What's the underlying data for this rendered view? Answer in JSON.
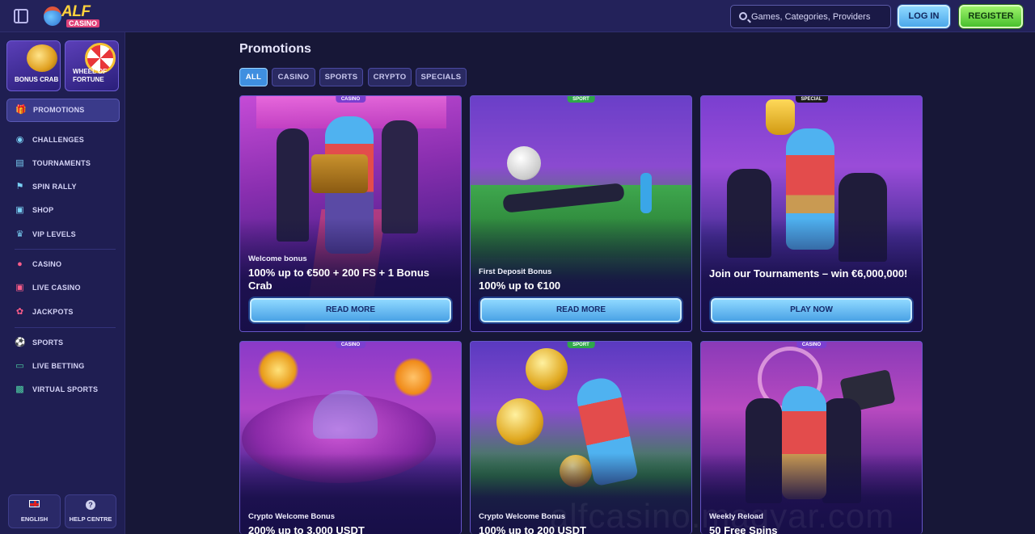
{
  "header": {
    "logo_text": "ALF",
    "logo_sub": "CASINO",
    "search_placeholder": "Games, Categories, Providers",
    "login_label": "LOG IN",
    "register_label": "REGISTER"
  },
  "sidebar": {
    "tiles": [
      {
        "label": "BONUS CRAB"
      },
      {
        "label": "WHEEL OF FORTUNE"
      }
    ],
    "active_item": {
      "label": "PROMOTIONS",
      "icon": "gift-icon"
    },
    "groups": [
      [
        {
          "label": "CHALLENGES",
          "icon": "medal-icon"
        },
        {
          "label": "TOURNAMENTS",
          "icon": "podium-icon"
        },
        {
          "label": "SPIN RALLY",
          "icon": "flag-icon"
        },
        {
          "label": "SHOP",
          "icon": "bag-icon"
        },
        {
          "label": "VIP LEVELS",
          "icon": "crown-icon"
        }
      ],
      [
        {
          "label": "CASINO",
          "icon": "cherry-icon"
        },
        {
          "label": "LIVE CASINO",
          "icon": "dice-icon"
        },
        {
          "label": "JACKPOTS",
          "icon": "clover-icon"
        }
      ],
      [
        {
          "label": "SPORTS",
          "icon": "ball-icon"
        },
        {
          "label": "LIVE BETTING",
          "icon": "live-icon"
        },
        {
          "label": "VIRTUAL SPORTS",
          "icon": "gamepad-icon"
        }
      ]
    ],
    "bottom": {
      "language_label": "ENGLISH",
      "help_label": "HELP CENTRE"
    }
  },
  "main": {
    "title": "Promotions",
    "filters": [
      "ALL",
      "CASINO",
      "SPORTS",
      "CRYPTO",
      "SPECIALS"
    ],
    "active_filter": "ALL",
    "cards": [
      {
        "tag": "CASINO",
        "subtitle": "Welcome bonus",
        "title": "100% up to €500 + 200 FS + 1 Bonus Crab",
        "cta": "READ MORE"
      },
      {
        "tag": "SPORT",
        "subtitle": "First Deposit Bonus",
        "title": "100% up to €100",
        "cta": "READ MORE"
      },
      {
        "tag": "SPECIAL",
        "subtitle": "",
        "title": "Join our Tournaments – win €6,000,000!",
        "cta": "PLAY NOW"
      },
      {
        "tag": "CASINO",
        "subtitle": "Crypto Welcome Bonus",
        "title": "200% up to 3,000 USDT",
        "cta": ""
      },
      {
        "tag": "SPORT",
        "subtitle": "Crypto Welcome Bonus",
        "title": "100% up to 200 USDT",
        "cta": ""
      },
      {
        "tag": "CASINO",
        "subtitle": "Weekly Reload",
        "title": "50 Free Spins",
        "cta": ""
      }
    ]
  },
  "watermark": "alfcasino.magyar.com",
  "colors": {
    "background": "#171737",
    "sidebar": "#1f1e52",
    "accent_blue": "#4aa3e6",
    "register_green": "#48c02d",
    "tag_casino": "#7b3fd0",
    "tag_sport": "#2fa84a",
    "tag_special": "#1a1a1a"
  }
}
